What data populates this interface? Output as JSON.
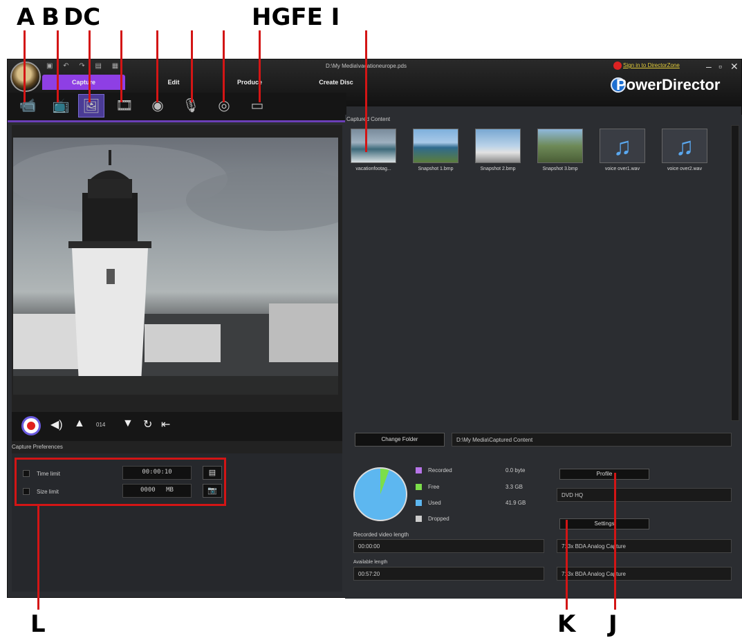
{
  "annotations": {
    "A": "A",
    "B": "B",
    "DC": "DC",
    "HGFEI": "HGFE I",
    "L": "L",
    "K": "K",
    "J": "J"
  },
  "window": {
    "file_path": "D:\\My Media\\vacationeurope.pds",
    "sign_in": "Sign in to DirectorZone",
    "brand": "PowerDirector",
    "tabs": [
      "Capture",
      "Edit",
      "Produce",
      "Create Disc"
    ],
    "active_tab": "Capture"
  },
  "controls": {
    "frame_counter": "014"
  },
  "preferences": {
    "header": "Capture Preferences",
    "time_limit_label": "Time limit",
    "time_limit_value": "00:00:10",
    "size_limit_label": "Size limit",
    "size_limit_value": "0000",
    "size_unit": "MB"
  },
  "captured": {
    "header": "Captured Content",
    "items": [
      {
        "label": "vacationfootag...",
        "type": "video"
      },
      {
        "label": "Snapshot 1.bmp",
        "type": "image"
      },
      {
        "label": "Snapshot 2.bmp",
        "type": "image"
      },
      {
        "label": "Snapshot 3.bmp",
        "type": "image"
      },
      {
        "label": "voice over1.wav",
        "type": "audio"
      },
      {
        "label": "voice over2.wav",
        "type": "audio"
      }
    ],
    "change_folder_label": "Change Folder",
    "folder_path": "D:\\My Media\\Captured Content"
  },
  "disk": {
    "legend": [
      {
        "label": "Recorded",
        "value": "0.0 byte",
        "color": "#b774e8"
      },
      {
        "label": "Free",
        "value": "3.3 GB",
        "color": "#7cde4a"
      },
      {
        "label": "Used",
        "value": "41.9 GB",
        "color": "#5db7f0"
      },
      {
        "label": "Dropped",
        "value": "",
        "color": "#cccccc"
      }
    ],
    "recorded_length_label": "Recorded video length",
    "recorded_length_value": "00:00:00",
    "available_length_label": "Available length",
    "available_length_value": "00:57:20"
  },
  "profile": {
    "profile_button": "Profile",
    "profile_value": "DVD HQ",
    "settings_button": "Settings",
    "device1": "713x BDA Analog Capture",
    "device2": "713x BDA Analog Capture"
  }
}
